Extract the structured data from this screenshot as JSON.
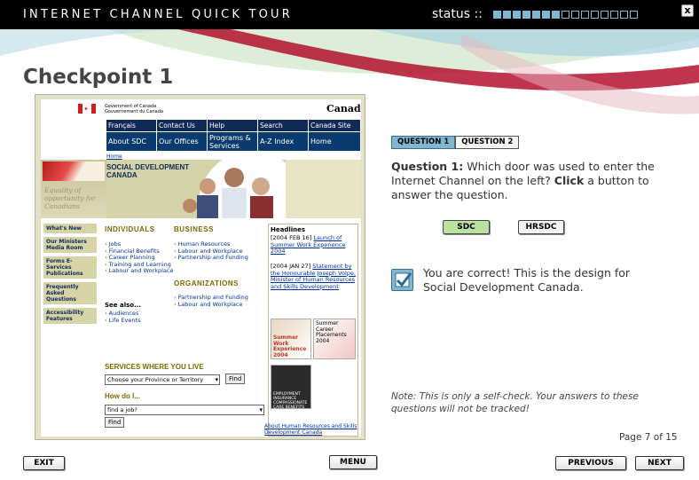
{
  "header": {
    "title": "INTERNET CHANNEL QUICK TOUR",
    "status_label": "status ::",
    "progress": {
      "completed": 7,
      "total": 15
    },
    "close_label": "x"
  },
  "checkpoint_title": "Checkpoint 1",
  "mini_site": {
    "gov_text": "Government of Canada  Gouvernement du Canada",
    "canada_wordmark": "Canada",
    "nav_row1": [
      "Français",
      "Contact Us",
      "Help",
      "Search",
      "Canada Site"
    ],
    "nav_row2": [
      "About SDC",
      "Our Offices",
      "Programs & Services",
      "A-Z Index",
      "Home"
    ],
    "home_link": "Home",
    "banner_title": "SOCIAL DEVELOPMENT CANADA",
    "banner_slogan": "Equality of opportunity for Canadians",
    "left_nav": [
      "What's New",
      "Our Ministers Media Room",
      "Forms E-Services Publications",
      "Frequently Asked Questions",
      "Accessibility Features"
    ],
    "individuals_heading": "INDIVIDUALS",
    "individuals_links": [
      "Jobs",
      "Financial Benefits",
      "Career Planning",
      "Training and Learning",
      "Labour and Workplace"
    ],
    "business_heading": "BUSINESS",
    "business_links": [
      "Human Resources",
      "Labour and Workplace",
      "Partnership and Funding"
    ],
    "organizations_heading": "ORGANIZATIONS",
    "organizations_links": [
      "Partnership and Funding",
      "Labour and Workplace"
    ],
    "see_also_label": "See also...",
    "see_also_links": [
      "Audiences",
      "Life Events"
    ],
    "headlines_title": "Headlines",
    "headline1_date": "[2004 FEB 16]",
    "headline1_link": "Launch of Summer Work Experience 2004",
    "headline2_date": "[2004 JAN 27]",
    "headline2_link": "Statement by the Honourable Joseph Volpe, Minister of Human Resources and Skills Development",
    "thumb1_text": "Summer Work Experience 2004",
    "thumb2_text": "Summer Career Placements 2004",
    "thumb3_text": "EMPLOYMENT INSURANCE COMPASSIONATE CARE BENEFITS",
    "services_heading": "SERVICES WHERE YOU LIVE",
    "province_select": "Choose your Province or Territory",
    "find_label": "Find",
    "howdo_heading": "How do I...",
    "howdo_select": "find a job?",
    "about_link": "About Human Resources and Skills Development Canada"
  },
  "question_tabs": [
    "QUESTION 1",
    "QUESTION 2"
  ],
  "question": {
    "label": "Question 1:",
    "text_before": "Which door was used to enter the Internet Channel on the left?",
    "click_word": "Click",
    "text_after": "a button to answer the question."
  },
  "answers": {
    "sdc": "SDC",
    "hrsdc": "HRSDC"
  },
  "feedback": "You are correct! This is the design for Social Development Canada.",
  "note": "Note: This is only a self-check. Your answers to these questions will not be tracked!",
  "page_count": "Page 7 of 15",
  "buttons": {
    "exit": "EXIT",
    "menu": "MENU",
    "previous": "PREVIOUS",
    "next": "NEXT"
  },
  "colors": {
    "accent": "#7fb7d2",
    "correct": "#b9e29f",
    "header_bg": "#000000",
    "site_nav": "#0f2a57"
  }
}
